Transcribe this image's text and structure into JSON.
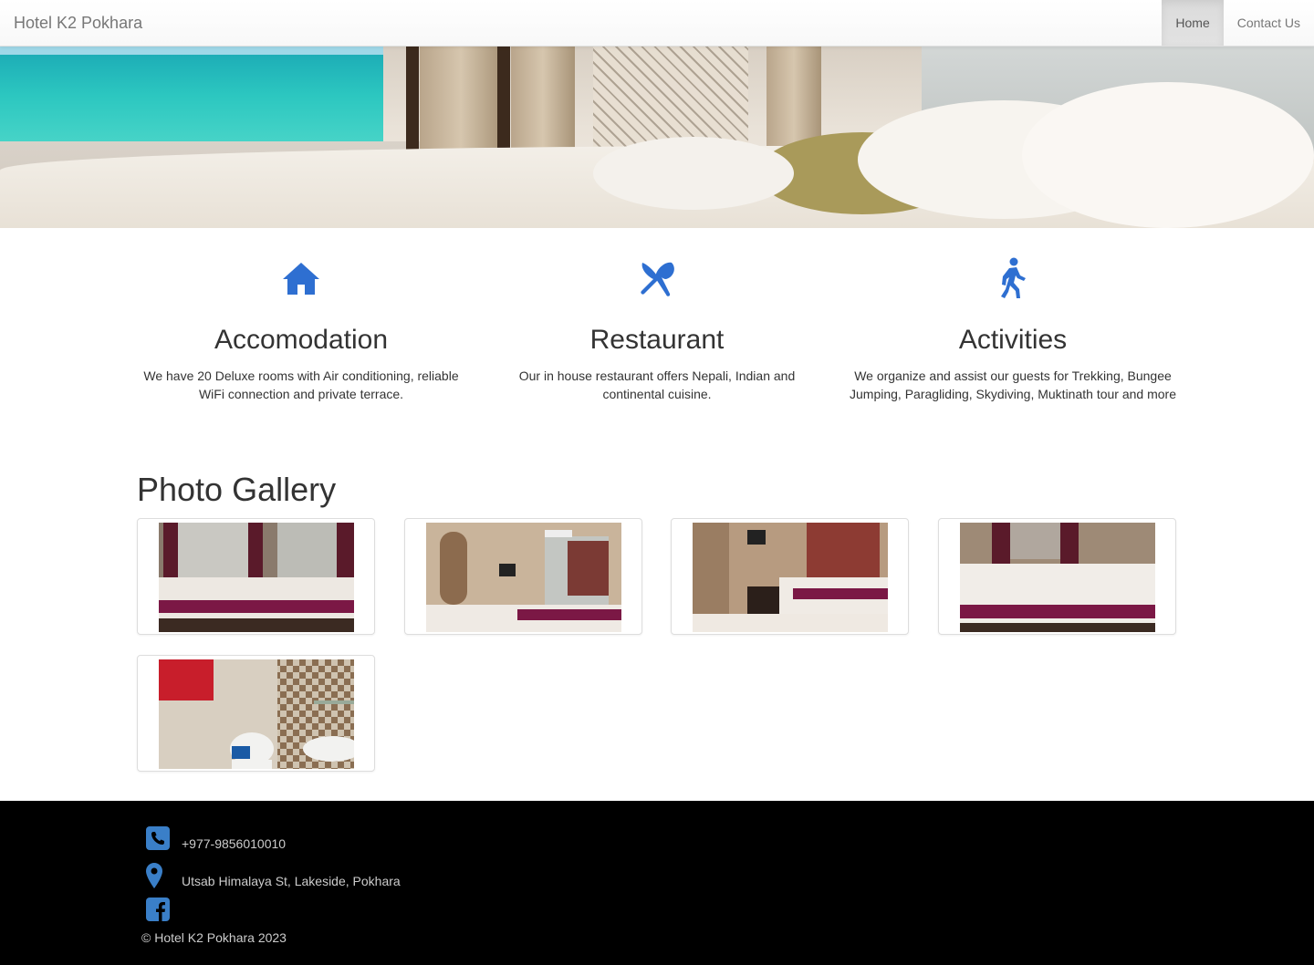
{
  "nav": {
    "brand": "Hotel K2 Pokhara",
    "links": [
      {
        "label": "Home",
        "active": true
      },
      {
        "label": "Contact Us",
        "active": false
      }
    ]
  },
  "features": [
    {
      "icon": "home-icon",
      "title": "Accomodation",
      "text": "We have 20 Deluxe rooms with Air conditioning, reliable WiFi connection and private terrace."
    },
    {
      "icon": "utensils-icon",
      "title": "Restaurant",
      "text": "Our in house restaurant offers Nepali, Indian and continental cuisine."
    },
    {
      "icon": "walking-icon",
      "title": "Activities",
      "text": "We organize and assist our guests for Trekking, Bungee Jumping, Paragliding, Skydiving, Muktinath tour and more"
    }
  ],
  "gallery": {
    "title": "Photo Gallery",
    "photos": [
      "bedroom-photo-1",
      "bedroom-photo-2",
      "bedroom-photo-3",
      "bedroom-photo-4",
      "bathroom-photo"
    ]
  },
  "footer": {
    "phone": "+977-9856010010",
    "address": "Utsab Himalaya St, Lakeside, Pokhara",
    "copyright": "© Hotel K2 Pokhara 2023",
    "icons": [
      "phone-icon",
      "map-marker-icon",
      "facebook-icon"
    ]
  },
  "colors": {
    "accent": "#2e6fd1",
    "footer_bg": "#000000",
    "footer_icon": "#3a7fc8"
  }
}
